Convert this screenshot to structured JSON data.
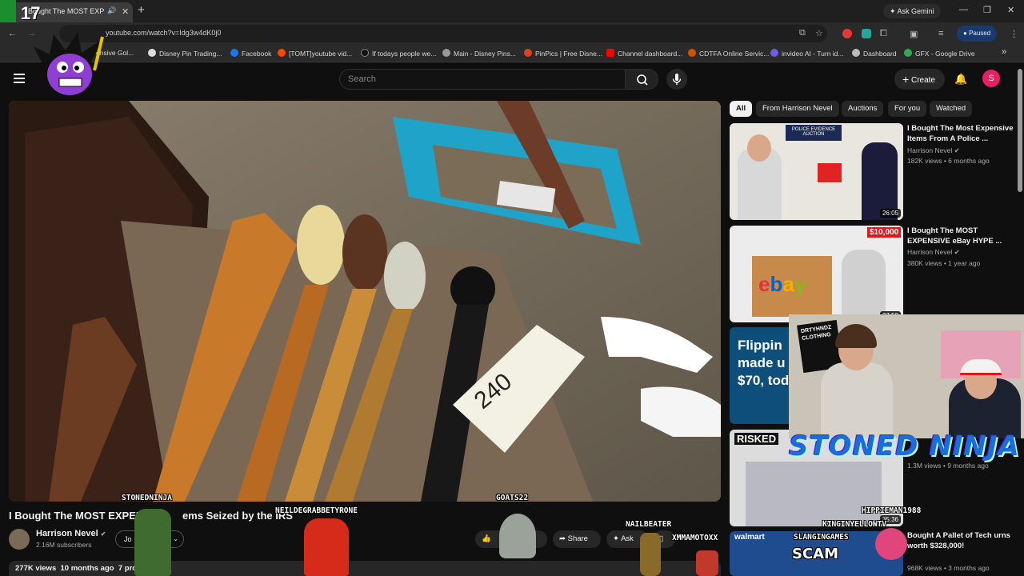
{
  "browser": {
    "tab_title": "I Bought The MOST EXPENSIVE Items Seized by the IRS",
    "new_tab": "+",
    "ask_gemini": "Ask Gemini",
    "url": "youtube.com/watch?v=Idg3w4dK0j0",
    "profile_status": "Paused",
    "bookmarks": [
      {
        "label": "Disney Pin Trading...",
        "color": "#dddddd"
      },
      {
        "label": "Facebook",
        "color": "#1877f2"
      },
      {
        "label": "[TOMT]youtube vid...",
        "color": "#ff4500"
      },
      {
        "label": "If todays people we...",
        "color": "#111111"
      },
      {
        "label": "Main - Disney Pins...",
        "color": "#999999"
      },
      {
        "label": "PinPics | Free Disne...",
        "color": "#e2401c"
      },
      {
        "label": "Channel dashboard...",
        "color": "#ff0000"
      },
      {
        "label": "CDTFA Online Servic...",
        "color": "#d35400"
      },
      {
        "label": "invideo AI - Turn id...",
        "color": "#6c5ce7"
      },
      {
        "label": "Dashboard",
        "color": "#bbbbbb"
      },
      {
        "label": "GFX - Google Drive",
        "color": "#34a853"
      }
    ],
    "bookmark_partial": "ensive Gol..."
  },
  "header": {
    "search_placeholder": "Search",
    "create_label": "Create",
    "avatar_letter": "S"
  },
  "video": {
    "title": "I Bought The MOST EXPENS",
    "title_tail": "ems Seized by the IRS",
    "channel": "Harrison Nevel",
    "subscribers": "2.16M subscribers",
    "join_label": "Jo",
    "share_label": "Share",
    "ask_label": "Ask",
    "views": "277K views",
    "age": "10 months ago",
    "description_start": "7 produc"
  },
  "chips": [
    "All",
    "From Harrison Nevel",
    "Auctions",
    "For you",
    "Watched"
  ],
  "recommendations": [
    {
      "title": "I Bought The Most Expensive Items From A Police ...",
      "channel": "Harrison Nevel",
      "views": "182K views",
      "age": "6 months ago",
      "duration": "26:05",
      "thumb_label": "POLICE EVIDENCE AUCTION"
    },
    {
      "title": "I Bought The MOST EXPENSIVE eBay HYPE ...",
      "channel": "Harrison Nevel",
      "views": "380K views",
      "age": "1 year ago",
      "duration": "27:50",
      "thumb_label": "ebay",
      "badge": "$10,000"
    },
    {
      "title": "",
      "channel": "",
      "views": "",
      "age": "",
      "duration": "",
      "thumb_label": "Flippin made u $70, tod"
    },
    {
      "title": "",
      "channel": "",
      "views": "1.3M views",
      "age": "9 months ago",
      "duration": "35:36",
      "thumb_label": "RISKED"
    },
    {
      "title": "Bought A Pallet of Tech urns worth $328,000!",
      "channel": "",
      "views": "968K views",
      "age": "3 months ago",
      "duration": "",
      "thumb_label": "walmart"
    }
  ],
  "overlays": {
    "counter": "17",
    "stoned_ninja": "STONED NINJA",
    "chat_names": [
      "STONEDNINJA",
      "NEILDEGRABBETYRONE",
      "GOATS22",
      "NAILBEATER",
      "XMMAMOTOXX",
      "HIPPIEMAN1988",
      "KINGINYELLOWTV",
      "SLANGINGAMES"
    ],
    "cam_label": "DRTYHNDZ CLOTHING",
    "scam_text": "SCAM",
    "tag_number": "240"
  },
  "colors": {
    "background": "#0f0f0f",
    "accent_red": "#ff0000",
    "avatar": "#e91e63",
    "ninja_text": "#1a6fd6"
  }
}
